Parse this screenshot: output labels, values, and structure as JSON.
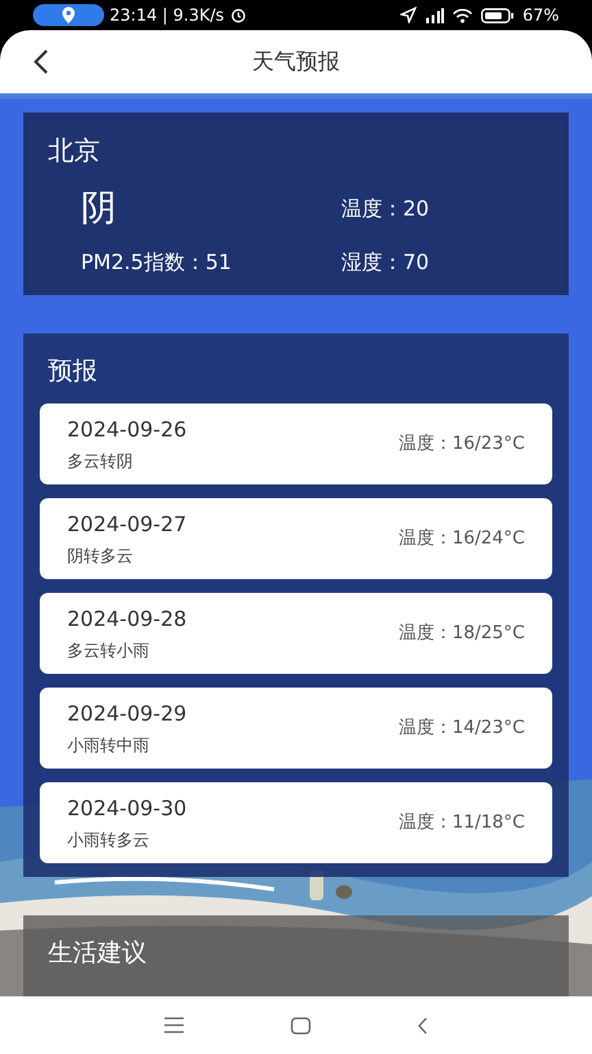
{
  "status_bar": {
    "time": "23:14 | 9.3K/s",
    "battery": "67%"
  },
  "header": {
    "title": "天气预报"
  },
  "current": {
    "city": "北京",
    "condition": "阴",
    "temperature": "温度：20",
    "pm25": "PM2.5指数：51",
    "humidity": "湿度：70"
  },
  "forecast": {
    "title": "预报",
    "days": [
      {
        "date": "2024-09-26",
        "weather": "多云转阴",
        "temp": "温度：16/23°C"
      },
      {
        "date": "2024-09-27",
        "weather": "阴转多云",
        "temp": "温度：16/24°C"
      },
      {
        "date": "2024-09-28",
        "weather": "多云转小雨",
        "temp": "温度：18/25°C"
      },
      {
        "date": "2024-09-29",
        "weather": "小雨转中雨",
        "temp": "温度：14/23°C"
      },
      {
        "date": "2024-09-30",
        "weather": "小雨转多云",
        "temp": "温度：11/18°C"
      }
    ]
  },
  "advice": {
    "title": "生活建议"
  }
}
